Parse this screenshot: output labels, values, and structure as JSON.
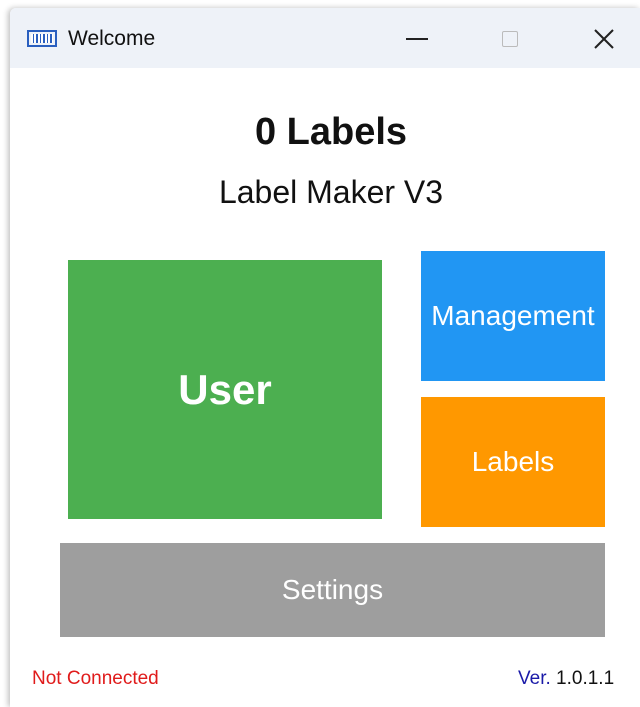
{
  "window": {
    "title": "Welcome",
    "icon": "barcode-icon"
  },
  "header": {
    "label_count": "0 Labels",
    "app_name": "Label Maker V3"
  },
  "tiles": {
    "user": {
      "label": "User",
      "color": "#4caf50"
    },
    "management": {
      "label": "Management",
      "color": "#2196f3"
    },
    "labels": {
      "label": "Labels",
      "color": "#ff9800"
    },
    "settings": {
      "label": "Settings",
      "color": "#9e9e9e"
    }
  },
  "footer": {
    "status": "Not Connected",
    "status_color": "#e01b1b",
    "version_prefix": "Ver.",
    "version_prefix_color": "#1a1aa8",
    "version_number": "1.0.1.1"
  }
}
